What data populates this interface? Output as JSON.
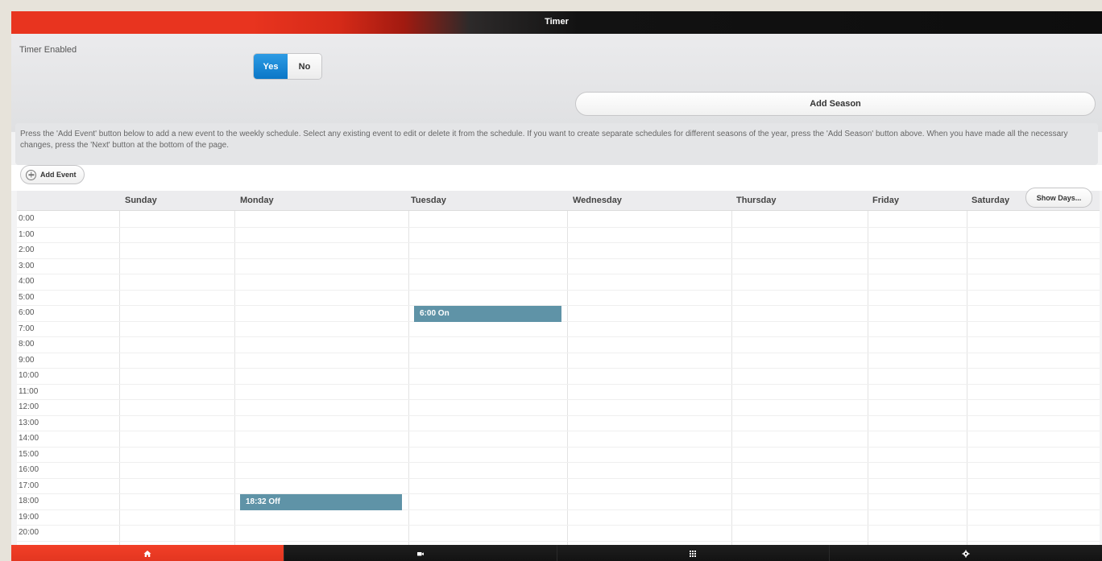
{
  "window": {
    "title": "Timer"
  },
  "timer_enabled": {
    "label": "Timer Enabled",
    "options": [
      "Yes",
      "No"
    ],
    "selected": "Yes"
  },
  "buttons": {
    "add_season": "Add Season",
    "add_event": "Add Event",
    "show_days": "Show Days..."
  },
  "instructions": "Press the 'Add Event' button below to add a new event to the weekly schedule. Select any existing event to edit or delete it from the schedule. If you want to create separate schedules for different seasons of the year, press the 'Add Season' button above. When you have made all the necessary changes, press the 'Next' button at the bottom of the page.",
  "schedule": {
    "days": [
      "Sunday",
      "Monday",
      "Tuesday",
      "Wednesday",
      "Thursday",
      "Friday",
      "Saturday"
    ],
    "hours": [
      "0:00",
      "1:00",
      "2:00",
      "3:00",
      "4:00",
      "5:00",
      "6:00",
      "7:00",
      "8:00",
      "9:00",
      "10:00",
      "11:00",
      "12:00",
      "13:00",
      "14:00",
      "15:00",
      "16:00",
      "17:00",
      "18:00",
      "19:00",
      "20:00"
    ],
    "events": [
      {
        "day": "Tuesday",
        "label": "6:00 On"
      },
      {
        "day": "Monday",
        "label": "18:32 Off"
      }
    ]
  },
  "tabs": [
    {
      "label": "Control",
      "icon": "home-icon",
      "active": true
    },
    {
      "label": "Scenes",
      "icon": "video-camera-icon",
      "active": false
    },
    {
      "label": "Reports",
      "icon": "grid-icon",
      "active": false
    },
    {
      "label": "Settings",
      "icon": "gear-icon",
      "active": false
    }
  ],
  "colors": {
    "accent_red": "#e8341f",
    "selected_blue": "#0b77c7",
    "event_blue": "#5f93a7"
  }
}
